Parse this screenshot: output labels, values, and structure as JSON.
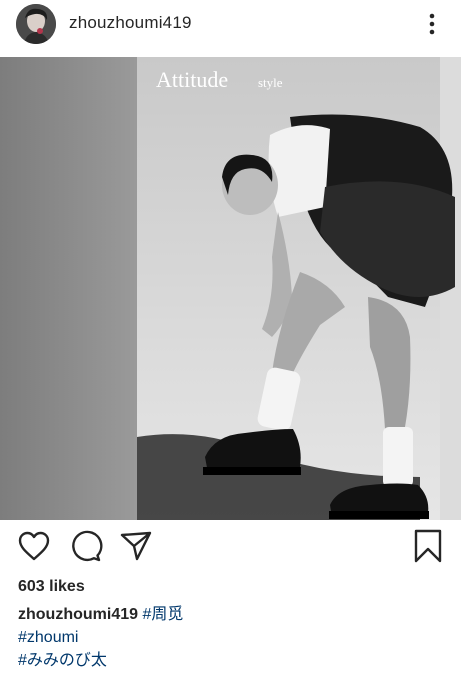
{
  "post": {
    "username": "zhouzhoumi419",
    "image_wordmark": "Attitude",
    "image_wordmark_suffix": "style",
    "likes": "603 likes",
    "caption_author": "zhouzhoumi419",
    "hashtags": [
      "#周觅",
      "#zhoumi",
      "#みみのび太"
    ]
  },
  "icons": {
    "more": "more-vertical-icon",
    "like": "heart-icon",
    "comment": "comment-icon",
    "share": "send-icon",
    "save": "bookmark-icon"
  },
  "colors": {
    "text": "#262626",
    "hashtag": "#00376b",
    "background": "#ffffff"
  }
}
